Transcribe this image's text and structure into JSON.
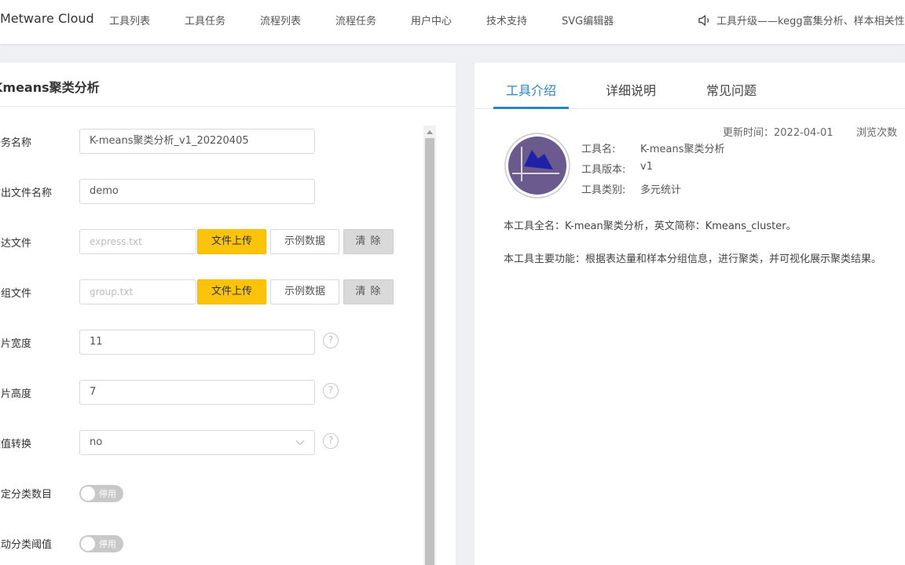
{
  "brand": "Metware Cloud",
  "nav": [
    "工具列表",
    "工具任务",
    "流程列表",
    "流程任务",
    "用户中心",
    "技术支持",
    "SVG编辑器"
  ],
  "notice": "工具升级——kegg富集分析、样本相关性分析",
  "form": {
    "title": "Kmeans聚类分析",
    "fields": {
      "task_name": {
        "label": "任务名称",
        "value": "K-means聚类分析_v1_20220405"
      },
      "output_name": {
        "label": "输出文件名称",
        "value": "demo"
      },
      "express_file": {
        "label": "表达文件",
        "placeholder": "express.txt"
      },
      "group_file": {
        "label": "分组文件",
        "placeholder": "group.txt"
      },
      "width": {
        "label": "图片宽度",
        "value": "11"
      },
      "height": {
        "label": "图片高度",
        "value": "7"
      },
      "transform": {
        "label": "数值转换",
        "value": "no"
      },
      "fixed_k": {
        "label": "固定分类数目",
        "state": "停用"
      },
      "auto_k": {
        "label": "自动分类阈值",
        "state": "停用"
      }
    },
    "buttons": {
      "upload": "文件上传",
      "sample": "示例数据",
      "clear": "清 除"
    }
  },
  "tabs": [
    "工具介绍",
    "详细说明",
    "常见问题"
  ],
  "tool": {
    "updated": "更新时间：2022-04-01",
    "views": "浏览次数",
    "name_label": "工具名:",
    "name": "K-means聚类分析",
    "version_label": "工具版本:",
    "version": "v1",
    "category_label": "工具类别:",
    "category": "多元统计",
    "desc1": "本工具全名：K-mean聚类分析，英文简称：Kmeans_cluster。",
    "desc2": "本工具主要功能：根据表达量和样本分组信息，进行聚类，并可视化展示聚类结果。"
  },
  "colors": {
    "accent": "#2a84c5",
    "upload": "#fcc30b",
    "logo_bg": "#6a5a8e"
  }
}
